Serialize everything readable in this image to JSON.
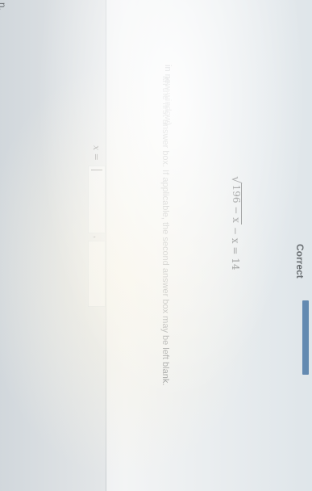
{
  "header": {
    "status": "Correct",
    "progress_color": "#2c5f96"
  },
  "side_text": "n.",
  "problem": {
    "radicand": "196 − x",
    "equation_rest": "− x = 14"
  },
  "help_link": "in new window)",
  "instructions": "ith the first answer box. If applicable, the second answer box may be left blank.",
  "answer": {
    "prefix": "x =",
    "separator": ","
  }
}
